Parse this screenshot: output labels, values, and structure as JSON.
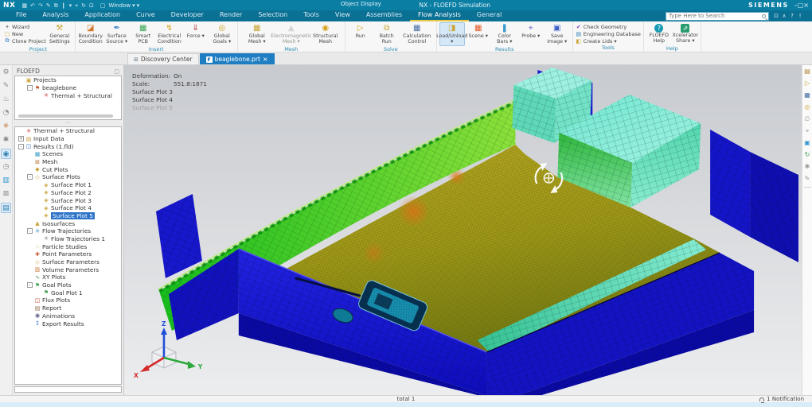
{
  "ui": {
    "caret": "▾",
    "window_icon": "▢"
  },
  "titlebar": {
    "app": "NX",
    "object_display": "Object Display",
    "title": "NX - FLOEFD Simulation",
    "brand": "SIEMENS",
    "window_label": "Window",
    "quick_icons": [
      {
        "g": "▦"
      },
      {
        "g": "↶"
      },
      {
        "g": "↷"
      },
      {
        "g": "✎"
      },
      {
        "g": "⧉"
      },
      {
        "g": "❙"
      },
      {
        "g": "▾"
      },
      {
        "g": "⌖"
      },
      {
        "g": "↻"
      },
      {
        "g": "⊡"
      }
    ],
    "window_buttons": [
      {
        "g": "–"
      },
      {
        "g": "▢"
      },
      {
        "g": "×"
      }
    ]
  },
  "menubar": {
    "items": [
      {
        "t": "File"
      },
      {
        "t": "Analysis"
      },
      {
        "t": "Application"
      },
      {
        "t": "Curve"
      },
      {
        "t": "Developer"
      },
      {
        "t": "Render"
      },
      {
        "t": "Selection"
      },
      {
        "t": "Tools"
      },
      {
        "t": "View"
      },
      {
        "t": "Assemblies"
      },
      {
        "t": "Flow Analysis",
        "cls": "act"
      },
      {
        "t": "General"
      }
    ],
    "search_placeholder": "Type Here to Search",
    "search_tools": [
      {
        "g": "⊡"
      },
      {
        "g": "∧"
      },
      {
        "g": "?"
      },
      {
        "g": "!"
      }
    ]
  },
  "ribbon": {
    "project": {
      "label": "Project",
      "smalls": [
        {
          "g": "✦",
          "c": "#8a8a9a",
          "label": "Wizard"
        },
        {
          "g": "▢",
          "c": "#caa53a",
          "label": "New"
        },
        {
          "g": "⧉",
          "c": "#3a7fc8",
          "label": "Clone Project"
        }
      ],
      "bigs": [
        {
          "g": "⚒",
          "c": "#caa53a",
          "label": "General Settings"
        }
      ]
    },
    "insert": {
      "label": "Insert",
      "bigs": [
        {
          "g": "◪",
          "c": "#d4762a",
          "label": "Boundary Condition ▾"
        },
        {
          "g": "✒",
          "c": "#3a7fc8",
          "label": "Surface Source ▾"
        },
        {
          "g": "▦",
          "c": "#3aa655",
          "label": "Smart PCB"
        },
        {
          "g": "↯",
          "c": "#d4a017",
          "label": "Electrical Condition ▾"
        },
        {
          "g": "⇓",
          "c": "#b03030",
          "label": "Force ▾"
        },
        {
          "g": "◎",
          "c": "#c8a020",
          "label": "Global Goals ▾"
        }
      ]
    },
    "mesh": {
      "label": "Mesh",
      "bigs": [
        {
          "g": "▦",
          "c": "#caa53a",
          "label": "Global Mesh ▾"
        },
        {
          "g": "▲",
          "c": "#b8b8b8",
          "label": "Electromagnetic Mesh ▾",
          "cls": "dis"
        },
        {
          "g": "◉",
          "c": "#d4a017",
          "label": "Structural Mesh (Default) ▾"
        }
      ]
    },
    "solve": {
      "label": "Solve",
      "bigs": [
        {
          "g": "▷",
          "c": "#d4a017",
          "label": "Run"
        },
        {
          "g": "⧉",
          "c": "#caa53a",
          "label": "Batch Run"
        },
        {
          "g": "▦",
          "c": "#4a6fa5",
          "label": "Calculation Control Options ▾"
        }
      ]
    },
    "results": {
      "label": "Results",
      "bigs": [
        {
          "g": "◨",
          "c": "#caa53a",
          "label": "Load/Unload ▾",
          "cls": "on"
        },
        {
          "g": "▦",
          "c": "#e05a2a",
          "label": "Scene ▾"
        },
        {
          "g": "❚",
          "c": "#3a9ad0",
          "label": "Color Bars ▾"
        },
        {
          "g": "⌖",
          "c": "#6a6ac8",
          "label": "Probe ▾"
        },
        {
          "g": "▣",
          "c": "#3a5fc8",
          "label": "Save Image ▾"
        }
      ]
    },
    "tools": {
      "label": "Tools",
      "smalls": [
        {
          "g": "✔",
          "c": "#8a3ac0",
          "label": "Check Geometry"
        },
        {
          "g": "▤",
          "c": "#2a7fb0",
          "label": "Engineering Database"
        },
        {
          "g": "◧",
          "c": "#caa53a",
          "label": "Create Lids ▾"
        }
      ]
    },
    "help": {
      "label": "Help",
      "bigs": [
        {
          "g": "?",
          "c": "#ffffff",
          "gcls": "circ",
          "label": "FLOEFD Help Topics ▾"
        },
        {
          "g": "⇗",
          "c": "#ffffff",
          "gcls": "circ2",
          "label": "Xcelerator Share ▾"
        }
      ]
    }
  },
  "tabs": {
    "items": [
      {
        "g": "⊞",
        "c": "#6a7a88",
        "label": "Discovery Center",
        "x": ""
      },
      {
        "g": "F",
        "c": "#1565a8",
        "label": "beaglebone.prt",
        "x": "×",
        "cls": "active"
      }
    ]
  },
  "left_strip": {
    "icons": [
      {
        "g": "⚙",
        "c": "#8a8a8a"
      },
      {
        "g": "✎",
        "c": "#8a8a8a"
      },
      {
        "g": "♨",
        "c": "#8a8a8a"
      },
      {
        "g": "◔",
        "c": "#8a8a8a"
      },
      {
        "g": "✳",
        "c": "#c06a2a"
      },
      {
        "g": "✱",
        "c": "#8a8a8a"
      },
      {
        "g": "◉",
        "c": "#2a7fb0",
        "cls": "selic"
      },
      {
        "g": "◷",
        "c": "#8a8a8a"
      },
      {
        "g": "▥",
        "c": "#3a9ad0"
      },
      {
        "g": "⊠",
        "c": "#8a8a8a"
      },
      {
        "g": "▤",
        "c": "#2a7fb0",
        "cls": "selic"
      }
    ]
  },
  "right_strip": {
    "icons": [
      {
        "g": "▤",
        "c": "#b08a3a"
      },
      {
        "g": "▷",
        "c": "#caa53a"
      },
      {
        "g": "▦",
        "c": "#4a6fa5"
      },
      {
        "g": "◎",
        "c": "#caa53a"
      },
      {
        "g": "∅",
        "c": "#9a9a9a"
      },
      {
        "g": "⌖",
        "c": "#9a9a9a"
      },
      {
        "g": "▣",
        "c": "#3a9ad0"
      },
      {
        "g": "↻",
        "c": "#3a9a4a"
      },
      {
        "g": "✱",
        "c": "#9a9a9a"
      },
      {
        "g": "✎",
        "c": "#9a9a9a"
      }
    ]
  },
  "left_panel": {
    "title": "FLOEFD",
    "collapse_icon": "▢",
    "project_tree": [
      {
        "label": "Projects",
        "depth": 0,
        "e": "",
        "g": "▣",
        "c": "#caa53a"
      },
      {
        "label": "beaglebone",
        "depth": 1,
        "e": "-",
        "g": "⚑",
        "c": "#c0522a"
      },
      {
        "label": "Thermal + Structural",
        "depth": 2,
        "e": "",
        "g": "✳",
        "c": "#cc4444"
      }
    ],
    "results_tree": [
      {
        "label": "Thermal + Structural",
        "depth": 0,
        "e": "",
        "g": "✳",
        "c": "#cc4444"
      },
      {
        "label": "Input Data",
        "depth": 0,
        "e": "+",
        "g": "▤",
        "c": "#c89a3a"
      },
      {
        "label": "Results (1.fld)",
        "depth": 0,
        "e": "-",
        "g": "◫",
        "c": "#3a6fc8"
      },
      {
        "label": "Scenes",
        "depth": 1,
        "e": "",
        "g": "▦",
        "c": "#3aa0c8"
      },
      {
        "label": "Mesh",
        "depth": 1,
        "e": "",
        "g": "⊞",
        "c": "#b06a2a"
      },
      {
        "label": "Cut Plots",
        "depth": 1,
        "e": "",
        "g": "◆",
        "c": "#caa53a"
      },
      {
        "label": "Surface Plots",
        "depth": 1,
        "e": "-",
        "g": "◇",
        "c": "#caa53a"
      },
      {
        "label": "Surface Plot 1",
        "depth": 2,
        "e": "",
        "g": "◈",
        "c": "#caa53a"
      },
      {
        "label": "Surface Plot 2",
        "depth": 2,
        "e": "",
        "g": "◈",
        "c": "#caa53a"
      },
      {
        "label": "Surface Plot 3",
        "depth": 2,
        "e": "",
        "g": "◈",
        "c": "#caa53a"
      },
      {
        "label": "Surface Plot 4",
        "depth": 2,
        "e": "",
        "g": "◈",
        "c": "#caa53a"
      },
      {
        "label": "Surface Plot 5",
        "depth": 2,
        "e": "",
        "g": "◈",
        "c": "#caa53a",
        "cls": "sel"
      },
      {
        "label": "Isosurfaces",
        "depth": 1,
        "e": "",
        "g": "▲",
        "c": "#caa53a"
      },
      {
        "label": "Flow Trajectories",
        "depth": 1,
        "e": "-",
        "g": "✳",
        "c": "#3a8fc8"
      },
      {
        "label": "Flow Trajectories 1",
        "depth": 2,
        "e": "",
        "g": "✳",
        "c": "#8a8a8a"
      },
      {
        "label": "Particle Studies",
        "depth": 1,
        "e": "",
        "g": "∴",
        "c": "#b0a03a"
      },
      {
        "label": "Point Parameters",
        "depth": 1,
        "e": "",
        "g": "✚",
        "c": "#c85a3a"
      },
      {
        "label": "Surface Parameters",
        "depth": 1,
        "e": "",
        "g": "◇",
        "c": "#caa53a"
      },
      {
        "label": "Volume Parameters",
        "depth": 1,
        "e": "",
        "g": "▥",
        "c": "#c87a3a"
      },
      {
        "label": "XY Plots",
        "depth": 1,
        "e": "",
        "g": "∿",
        "c": "#3a8f4a"
      },
      {
        "label": "Goal Plots",
        "depth": 1,
        "e": "-",
        "g": "⚑",
        "c": "#3a9a4a"
      },
      {
        "label": "Goal Plot 1",
        "depth": 2,
        "e": "",
        "g": "⚑",
        "c": "#3a9a4a"
      },
      {
        "label": "Flux Plots",
        "depth": 1,
        "e": "",
        "g": "◫",
        "c": "#c84a3a"
      },
      {
        "label": "Report",
        "depth": 1,
        "e": "",
        "g": "▤",
        "c": "#8a6a4a"
      },
      {
        "label": "Animations",
        "depth": 1,
        "e": "",
        "g": "◉",
        "c": "#5a5a8a"
      },
      {
        "label": "Export Results",
        "depth": 1,
        "e": "",
        "g": "↧",
        "c": "#3a6fc8"
      }
    ]
  },
  "viewport": {
    "overlay_status": [
      {
        "k": "Deformation:",
        "v": "On"
      },
      {
        "k": "Scale:",
        "v": "551.8:1871"
      }
    ],
    "overlay_plots": [
      {
        "label": "Surface Plot 3"
      },
      {
        "label": "Surface Plot 4"
      },
      {
        "label": "Surface Plot 5",
        "cls": "dim"
      }
    ],
    "triad": {
      "x": "X",
      "y": "Y",
      "z": "Z"
    }
  },
  "statusbar": {
    "total": "total 1",
    "notification": "1 Notification"
  }
}
